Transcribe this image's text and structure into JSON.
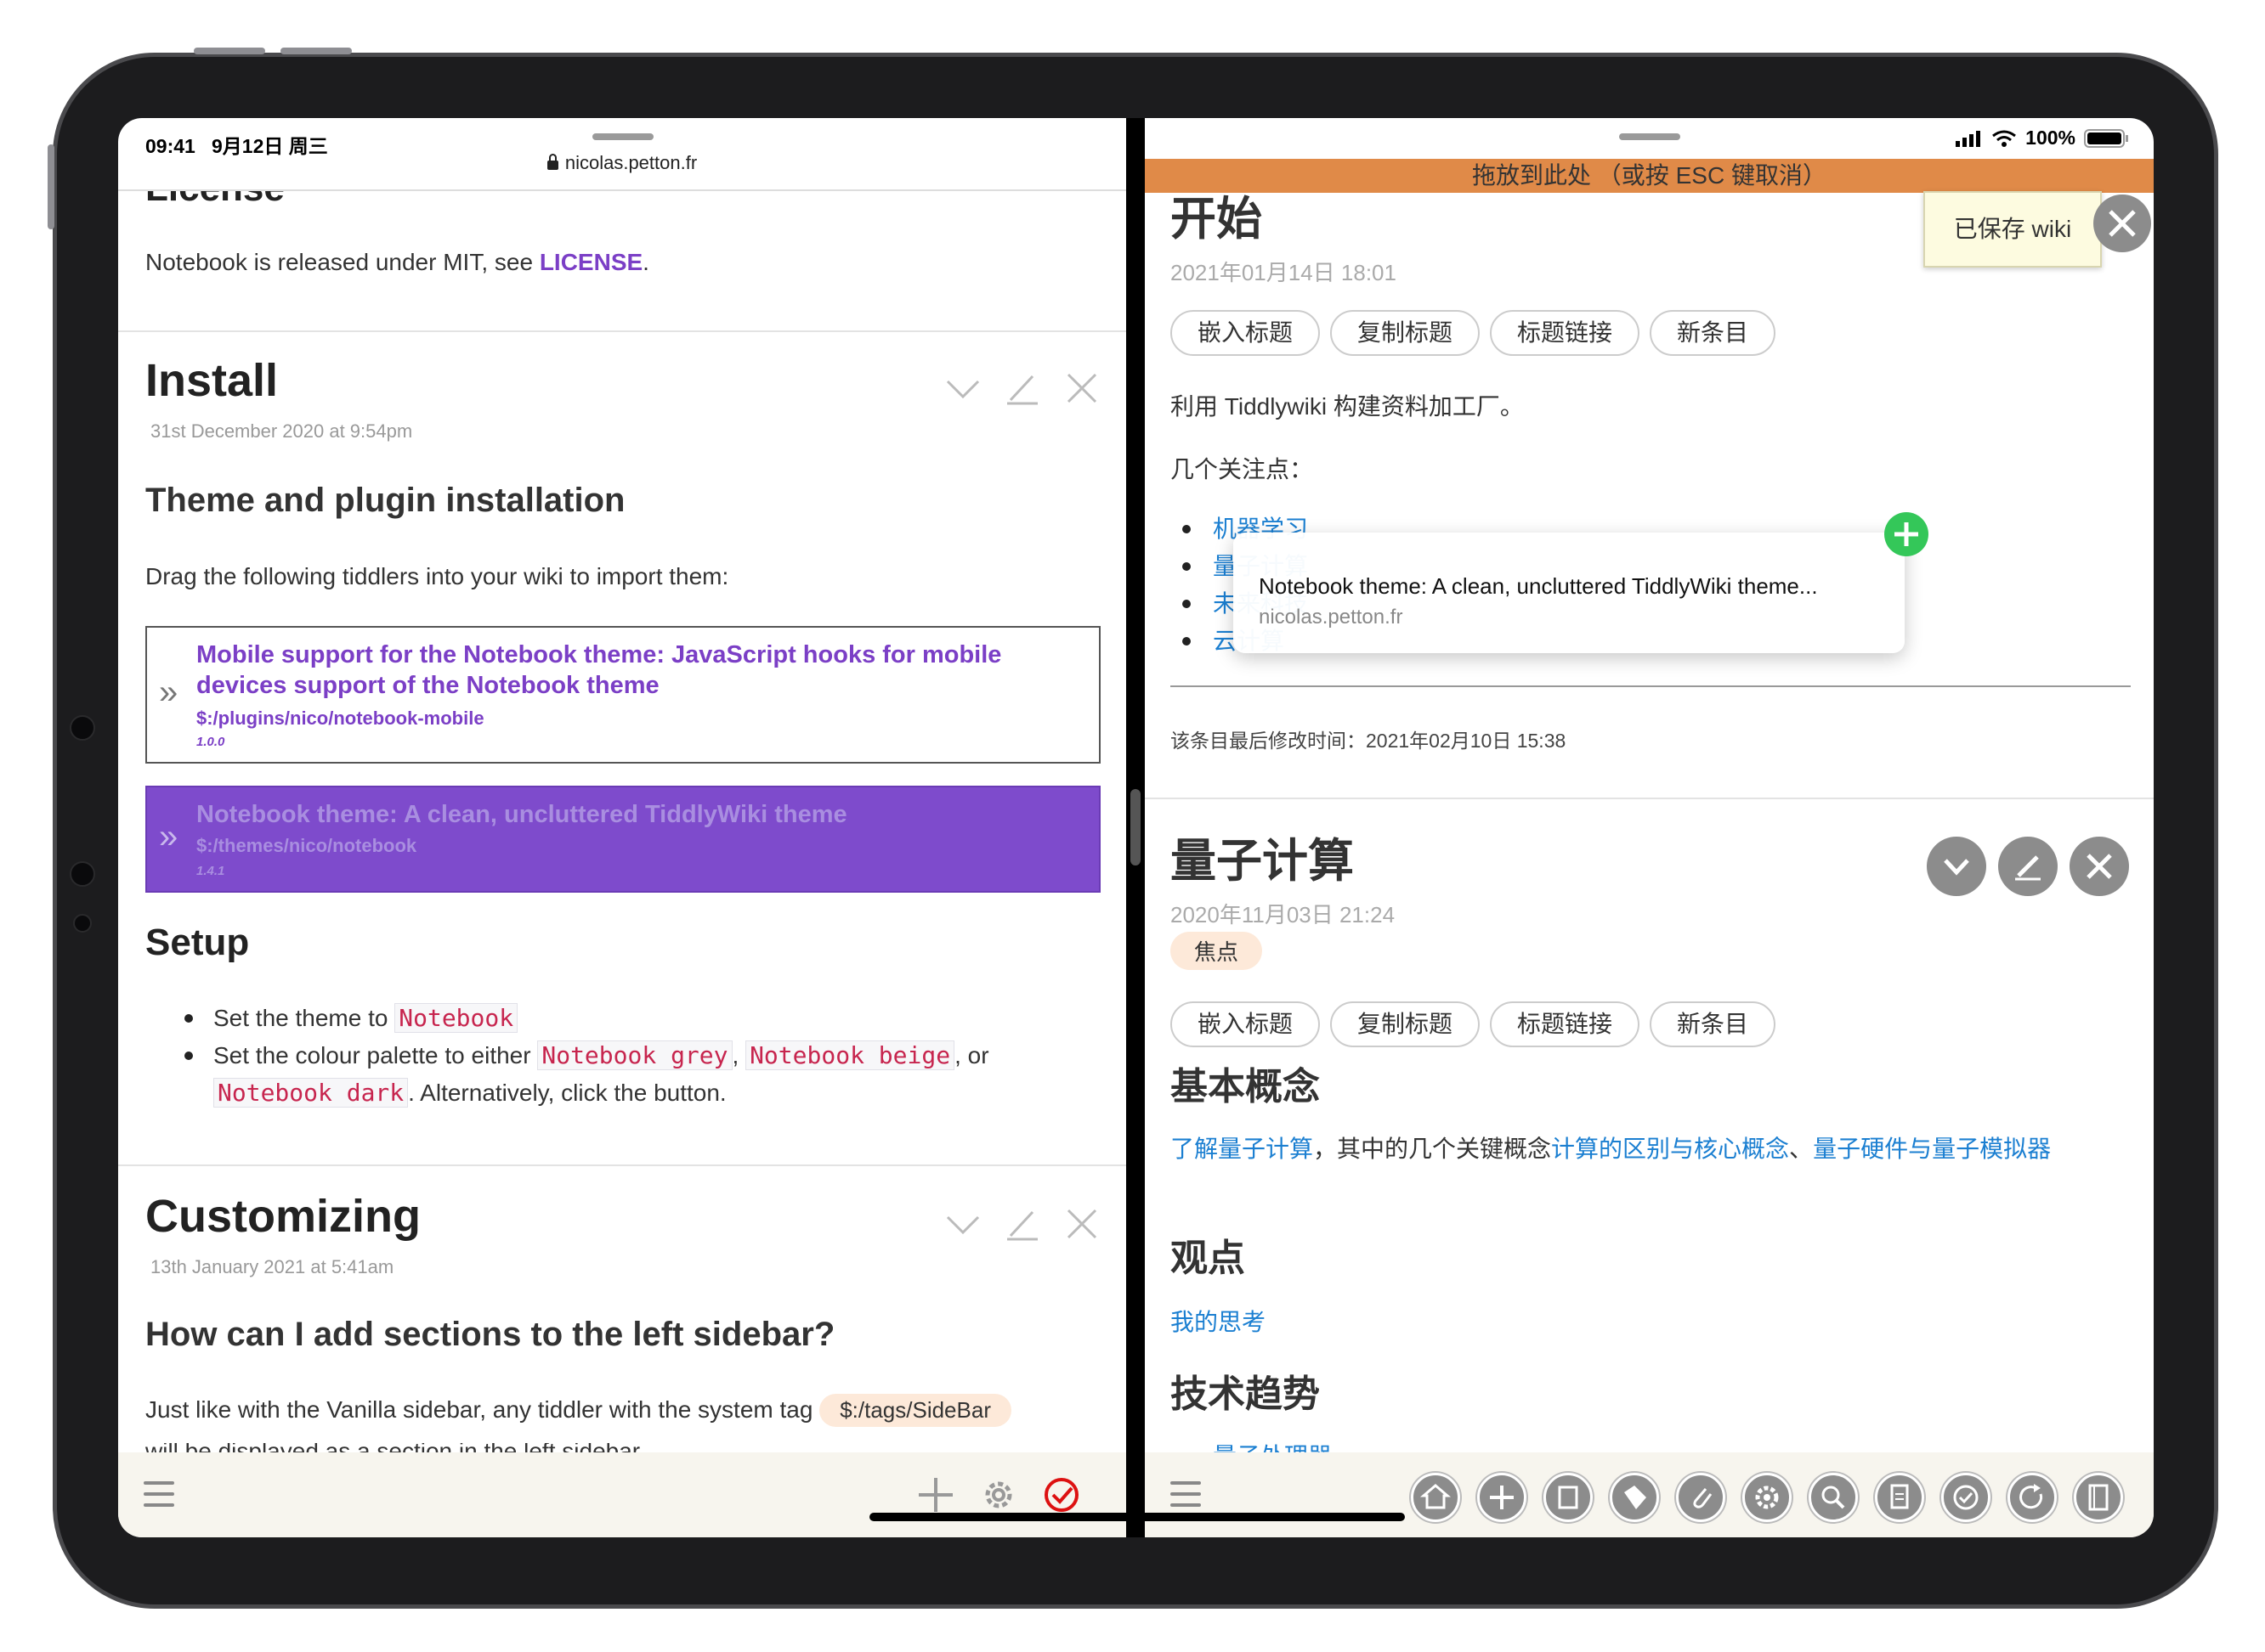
{
  "status": {
    "time": "09:41",
    "date": "9月12日 周三",
    "battery": "100%"
  },
  "left": {
    "url": "nicolas.petton.fr",
    "license": {
      "heading_partial": "License",
      "text_prefix": "Notebook is released under MIT, see ",
      "link": "LICENSE",
      "text_suffix": "."
    },
    "install": {
      "title": "Install",
      "date": "31st December 2020 at 9:54pm",
      "subheading": "Theme and plugin installation",
      "intro": "Drag the following tiddlers into your wiki to import them:",
      "plugins": [
        {
          "title": "Mobile support for the Notebook theme: JavaScript hooks for mobile devices support of the Notebook theme",
          "path": "$:/plugins/nico/notebook-mobile",
          "version": "1.0.0",
          "dragging": false
        },
        {
          "title": "Notebook theme: A clean, uncluttered TiddlyWiki theme",
          "path": "$:/themes/nico/notebook",
          "version": "1.4.1",
          "dragging": true
        }
      ],
      "setup_heading": "Setup",
      "setup_items": {
        "item1_prefix": "Set the theme to ",
        "item1_code": "Notebook",
        "item2_prefix": "Set the colour palette to either ",
        "item2_code1": "Notebook grey",
        "item2_sep1": ", ",
        "item2_code2": "Notebook beige",
        "item2_sep2": ", or",
        "item2_code3": "Notebook dark",
        "item2_suffix": ". Alternatively, click the button."
      }
    },
    "customizing": {
      "title": "Customizing",
      "date": "13th January 2021 at 5:41am",
      "subheading": "How can I add sections to the left sidebar?",
      "text_prefix": "Just like with the Vanilla sidebar, any tiddler with the system tag ",
      "tag": "$:/tags/SideBar",
      "text_cut": "will be displayed as a section in the left sidebar"
    },
    "toolbar_icons": [
      "chevron-down-icon",
      "pencil-icon",
      "close-icon"
    ],
    "bottom_icons": [
      "menu-icon",
      "plus-icon",
      "gear-icon",
      "check-circle-icon"
    ]
  },
  "right": {
    "drop_banner": "拖放到此处 （或按 ESC 键取消）",
    "saved_notice": "已保存 wiki",
    "tiddler1": {
      "title": "开始",
      "date": "2021年01月14日 18:01",
      "buttons": [
        "嵌入标题",
        "复制标题",
        "标题链接",
        "新条目"
      ],
      "body1": "利用 Tiddlywiki 构建资料加工厂。",
      "body2": "几个关注点：",
      "list": [
        "机器学习",
        "量子计算",
        "未来科技",
        "云计算"
      ],
      "footer": "该条目最后修改时间：2021年02月10日 15:38"
    },
    "drag_preview": {
      "title": "Notebook theme: A clean, uncluttered TiddlyWiki theme...",
      "url": "nicolas.petton.fr"
    },
    "tiddler2": {
      "title": "量子计算",
      "date": "2020年11月03日 21:24",
      "tag": "焦点",
      "buttons": [
        "嵌入标题",
        "复制标题",
        "标题链接",
        "新条目"
      ],
      "h_basic": "基本概念",
      "basic_link1": "了解量子计算",
      "basic_mid": "，其中的几个关键概念",
      "basic_link2": "计算的区别与核心概念",
      "basic_sep": "、",
      "basic_link3": "量子硬件与量子模拟器",
      "h_view": "观点",
      "view_link": "我的思考",
      "h_trend": "技术趋势",
      "trend_cut": "量子处理器"
    },
    "bottom_icons": [
      "menu-icon",
      "home-icon",
      "plus-icon",
      "import-icon",
      "tag-icon",
      "attachment-icon",
      "gear-icon",
      "search-icon",
      "page-icon",
      "check-icon",
      "refresh-icon",
      "book-icon"
    ]
  }
}
